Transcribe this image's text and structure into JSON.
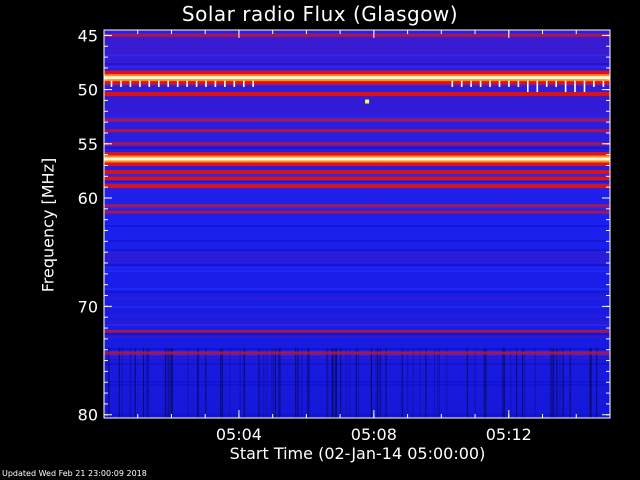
{
  "chart_data": {
    "type": "heatmap",
    "title": "Solar radio Flux (Glasgow)",
    "ylabel": "Frequency [MHz]",
    "xlabel": "Start Time (02-Jan-14 05:00:00)",
    "yaxis": {
      "reversed": true,
      "ylim": [
        44.5,
        80.3
      ]
    },
    "xaxis": {
      "xlim_minutes": [
        0,
        15
      ]
    },
    "y_ticks": [
      {
        "label": "45",
        "value": 45
      },
      {
        "label": "50",
        "value": 50
      },
      {
        "label": "55",
        "value": 55
      },
      {
        "label": "60",
        "value": 60
      },
      {
        "label": "70",
        "value": 70
      },
      {
        "label": "80",
        "value": 80
      }
    ],
    "x_ticks": [
      {
        "label": "05:04",
        "minutes": 4
      },
      {
        "label": "05:08",
        "minutes": 8
      },
      {
        "label": "05:12",
        "minutes": 12
      }
    ],
    "background_level": "low",
    "bands": [
      {
        "mhz": 45.0,
        "level": "elevated"
      },
      {
        "mhz": 48.9,
        "level": "very high"
      },
      {
        "mhz": 50.4,
        "level": "high"
      },
      {
        "mhz": 52.8,
        "level": "elevated"
      },
      {
        "mhz": 53.8,
        "level": "elevated"
      },
      {
        "mhz": 55.0,
        "level": "elevated"
      },
      {
        "mhz": 56.4,
        "level": "very high"
      },
      {
        "mhz": 57.6,
        "level": "high"
      },
      {
        "mhz": 58.2,
        "level": "high"
      },
      {
        "mhz": 58.9,
        "level": "high"
      },
      {
        "mhz": 60.7,
        "level": "elevated"
      },
      {
        "mhz": 61.3,
        "level": "elevated"
      },
      {
        "mhz": 72.3,
        "level": "elevated"
      },
      {
        "mhz": 74.3,
        "level": "elevated"
      }
    ],
    "spikes": [
      {
        "start_min": 0.2,
        "end_min": 4.5,
        "mhz": 49.2,
        "level": "high"
      },
      {
        "start_min": 10.3,
        "end_min": 15,
        "mhz": 49.2,
        "level": "high"
      }
    ],
    "point_sources": [
      {
        "minutes": 7.8,
        "mhz": 51.1,
        "level": "very high"
      }
    ],
    "colorscale": [
      "#000000",
      "#1414ff",
      "#3a1ad8",
      "#d61414",
      "#ff7a1e",
      "#ffff40",
      "#ffffff"
    ]
  },
  "footer": {
    "updated": "Updated Wed Feb 21 23:00:09 2018"
  }
}
